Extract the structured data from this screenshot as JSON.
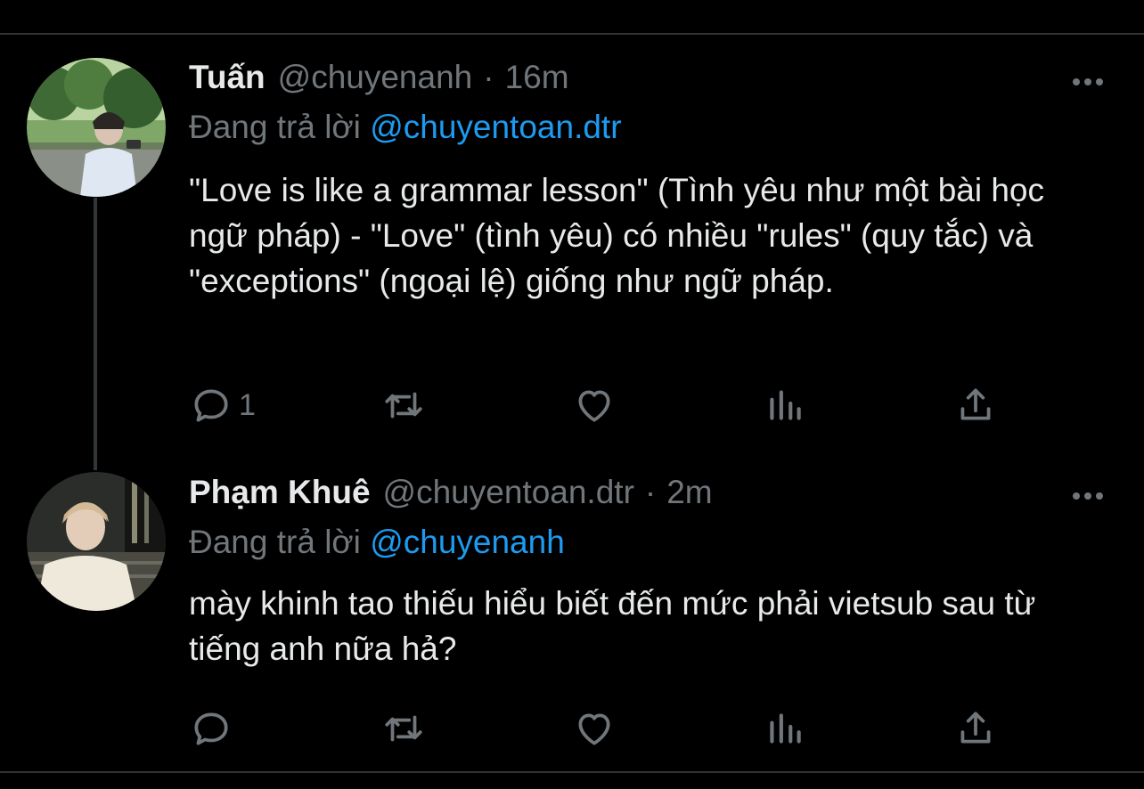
{
  "tweets": [
    {
      "name": "Tuấn",
      "handle": "@chuyenanh",
      "separator": "·",
      "time": "16m",
      "replying_label": "Đang trả lời ",
      "replying_to": "@chuyentoan.dtr",
      "text": "\"Love is like a grammar lesson\" (Tình yêu như một bài học ngữ pháp) - \"Love\" (tình yêu) có nhiều \"rules\" (quy tắc) và \"exceptions\" (ngoại lệ) giống như ngữ pháp.",
      "reply_count": "1"
    },
    {
      "name": "Phạm Khuê",
      "handle": "@chuyentoan.dtr",
      "separator": "·",
      "time": "2m",
      "replying_label": "Đang trả lời ",
      "replying_to": "@chuyenanh",
      "text": "mày khinh tao thiếu hiểu biết đến mức phải vietsub sau từ tiếng anh nữa hả?",
      "reply_count": ""
    }
  ],
  "icons": {
    "reply": "reply-icon",
    "retweet": "retweet-icon",
    "like": "heart-icon",
    "views": "views-icon",
    "share": "share-icon",
    "more": "more-icon"
  },
  "colors": {
    "background": "#000000",
    "text": "#e7e9ea",
    "muted": "#71767b",
    "link": "#1d9bf0",
    "divider": "#2f3336"
  }
}
